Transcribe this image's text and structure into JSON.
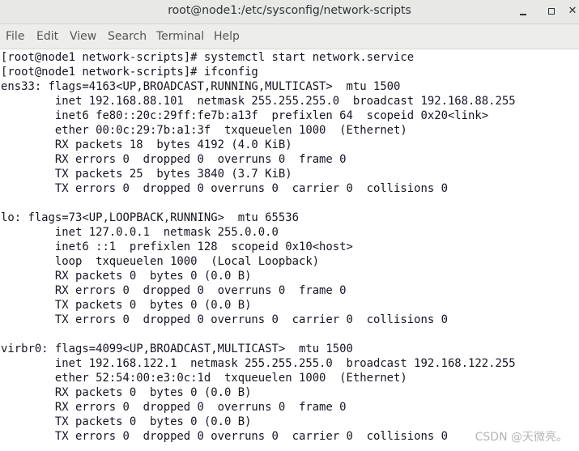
{
  "window": {
    "title": "root@node1:/etc/sysconfig/network-scripts",
    "minimize_icon": "minimize-icon",
    "maximize_icon": "maximize-icon",
    "close_label": "✕"
  },
  "menu": {
    "items": [
      "File",
      "Edit",
      "View",
      "Search",
      "Terminal",
      "Help"
    ]
  },
  "terminal": {
    "lines": [
      "[root@node1 network-scripts]# systemctl start network.service",
      "[root@node1 network-scripts]# ifconfig",
      "ens33: flags=4163<UP,BROADCAST,RUNNING,MULTICAST>  mtu 1500",
      "        inet 192.168.88.101  netmask 255.255.255.0  broadcast 192.168.88.255",
      "        inet6 fe80::20c:29ff:fe7b:a13f  prefixlen 64  scopeid 0x20<link>",
      "        ether 00:0c:29:7b:a1:3f  txqueuelen 1000  (Ethernet)",
      "        RX packets 18  bytes 4192 (4.0 KiB)",
      "        RX errors 0  dropped 0  overruns 0  frame 0",
      "        TX packets 25  bytes 3840 (3.7 KiB)",
      "        TX errors 0  dropped 0 overruns 0  carrier 0  collisions 0",
      "",
      "lo: flags=73<UP,LOOPBACK,RUNNING>  mtu 65536",
      "        inet 127.0.0.1  netmask 255.0.0.0",
      "        inet6 ::1  prefixlen 128  scopeid 0x10<host>",
      "        loop  txqueuelen 1000  (Local Loopback)",
      "        RX packets 0  bytes 0 (0.0 B)",
      "        RX errors 0  dropped 0  overruns 0  frame 0",
      "        TX packets 0  bytes 0 (0.0 B)",
      "        TX errors 0  dropped 0 overruns 0  carrier 0  collisions 0",
      "",
      "virbr0: flags=4099<UP,BROADCAST,MULTICAST>  mtu 1500",
      "        inet 192.168.122.1  netmask 255.255.255.0  broadcast 192.168.122.255",
      "        ether 52:54:00:e3:0c:1d  txqueuelen 1000  (Ethernet)",
      "        RX packets 0  bytes 0 (0.0 B)",
      "        RX errors 0  dropped 0  overruns 0  frame 0",
      "        TX packets 0  bytes 0 (0.0 B)",
      "        TX errors 0  dropped 0 overruns 0  carrier 0  collisions 0"
    ]
  },
  "watermark": "CSDN @天微亮。"
}
